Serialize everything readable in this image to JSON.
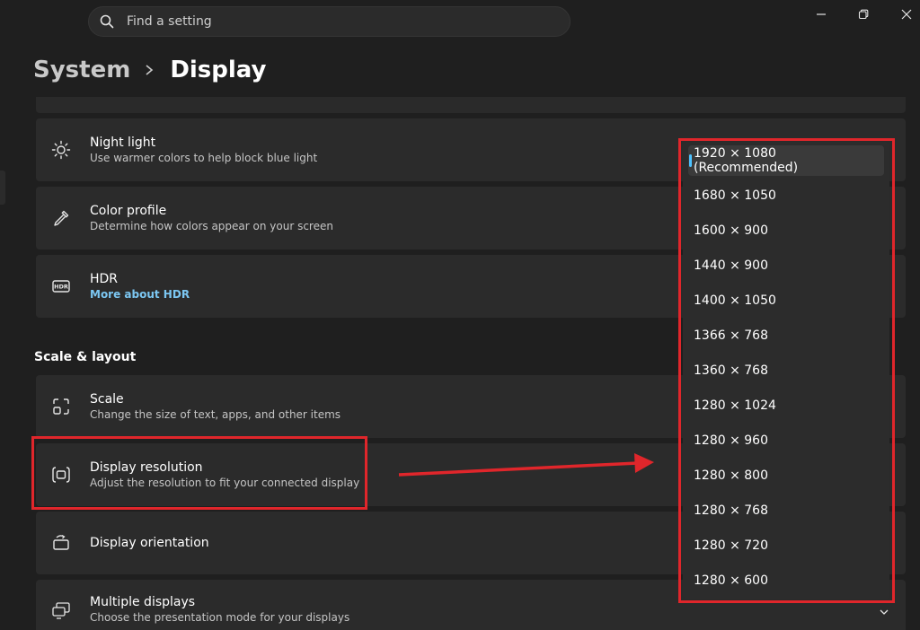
{
  "search": {
    "placeholder": "Find a setting"
  },
  "breadcrumb": {
    "parent": "System",
    "current": "Display"
  },
  "cards": {
    "night_light": {
      "title": "Night light",
      "subtitle": "Use warmer colors to help block blue light"
    },
    "color_profile": {
      "title": "Color profile",
      "subtitle": "Determine how colors appear on your screen"
    },
    "hdr": {
      "title": "HDR",
      "link": "More about HDR"
    },
    "scale": {
      "title": "Scale",
      "subtitle": "Change the size of text, apps, and other items"
    },
    "display_resolution": {
      "title": "Display resolution",
      "subtitle": "Adjust the resolution to fit your connected display"
    },
    "display_orientation": {
      "title": "Display orientation"
    },
    "multiple_displays": {
      "title": "Multiple displays",
      "subtitle": "Choose the presentation mode for your displays"
    }
  },
  "section": {
    "scale_layout": "Scale & layout"
  },
  "resolution_dropdown": {
    "options": [
      "1920 × 1080 (Recommended)",
      "1680 × 1050",
      "1600 × 900",
      "1440 × 900",
      "1400 × 1050",
      "1366 × 768",
      "1360 × 768",
      "1280 × 1024",
      "1280 × 960",
      "1280 × 800",
      "1280 × 768",
      "1280 × 720",
      "1280 × 600"
    ],
    "selected_index": 0
  },
  "colors": {
    "accent": "#4cc2ff",
    "annotation": "#e0262b",
    "link": "#7cc7f2",
    "background": "#1f1f1f",
    "card": "#2b2b2b"
  },
  "icons": {
    "search": "search-icon",
    "minimize": "minimize-icon",
    "restore": "restore-icon",
    "close": "close-icon",
    "night_light": "sun-icon",
    "color_profile": "eyedropper-icon",
    "hdr": "hdr-icon",
    "scale": "scale-icon",
    "display_resolution": "resolution-icon",
    "display_orientation": "orientation-icon",
    "multiple_displays": "multiple-displays-icon"
  }
}
